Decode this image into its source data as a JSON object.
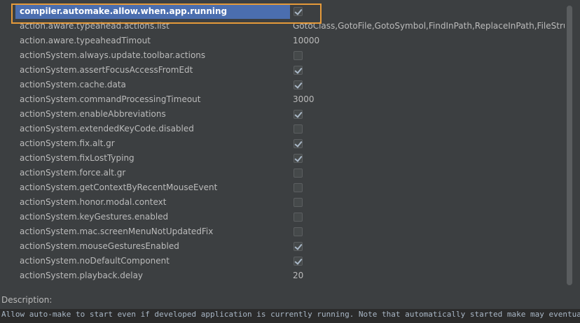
{
  "registry": {
    "rows": [
      {
        "key": "compiler.automake.allow.when.app.running",
        "type": "bool",
        "value": true,
        "selected": true
      },
      {
        "key": "action.aware.typeahead.actions.list",
        "type": "text",
        "value": "GotoClass,GotoFile,GotoSymbol,FindInPath,ReplaceInPath,FileStruct"
      },
      {
        "key": "action.aware.typeaheadTimout",
        "type": "text",
        "value": "10000"
      },
      {
        "key": "actionSystem.always.update.toolbar.actions",
        "type": "bool",
        "value": false
      },
      {
        "key": "actionSystem.assertFocusAccessFromEdt",
        "type": "bool",
        "value": true
      },
      {
        "key": "actionSystem.cache.data",
        "type": "bool",
        "value": true
      },
      {
        "key": "actionSystem.commandProcessingTimeout",
        "type": "text",
        "value": "3000"
      },
      {
        "key": "actionSystem.enableAbbreviations",
        "type": "bool",
        "value": true
      },
      {
        "key": "actionSystem.extendedKeyCode.disabled",
        "type": "bool",
        "value": false
      },
      {
        "key": "actionSystem.fix.alt.gr",
        "type": "bool",
        "value": true
      },
      {
        "key": "actionSystem.fixLostTyping",
        "type": "bool",
        "value": true
      },
      {
        "key": "actionSystem.force.alt.gr",
        "type": "bool",
        "value": false
      },
      {
        "key": "actionSystem.getContextByRecentMouseEvent",
        "type": "bool",
        "value": false
      },
      {
        "key": "actionSystem.honor.modal.context",
        "type": "bool",
        "value": false
      },
      {
        "key": "actionSystem.keyGestures.enabled",
        "type": "bool",
        "value": false
      },
      {
        "key": "actionSystem.mac.screenMenuNotUpdatedFix",
        "type": "bool",
        "value": false
      },
      {
        "key": "actionSystem.mouseGesturesEnabled",
        "type": "bool",
        "value": true
      },
      {
        "key": "actionSystem.noDefaultComponent",
        "type": "bool",
        "value": true
      },
      {
        "key": "actionSystem.playback.delay",
        "type": "text",
        "value": "20"
      }
    ]
  },
  "description": {
    "label": "Description:",
    "text": "Allow auto-make to start even if developed application is currently running. Note that automatically started make may eventually delete"
  },
  "colors": {
    "accent_highlight": "#e59a3a",
    "selection": "#4b6eaf"
  }
}
